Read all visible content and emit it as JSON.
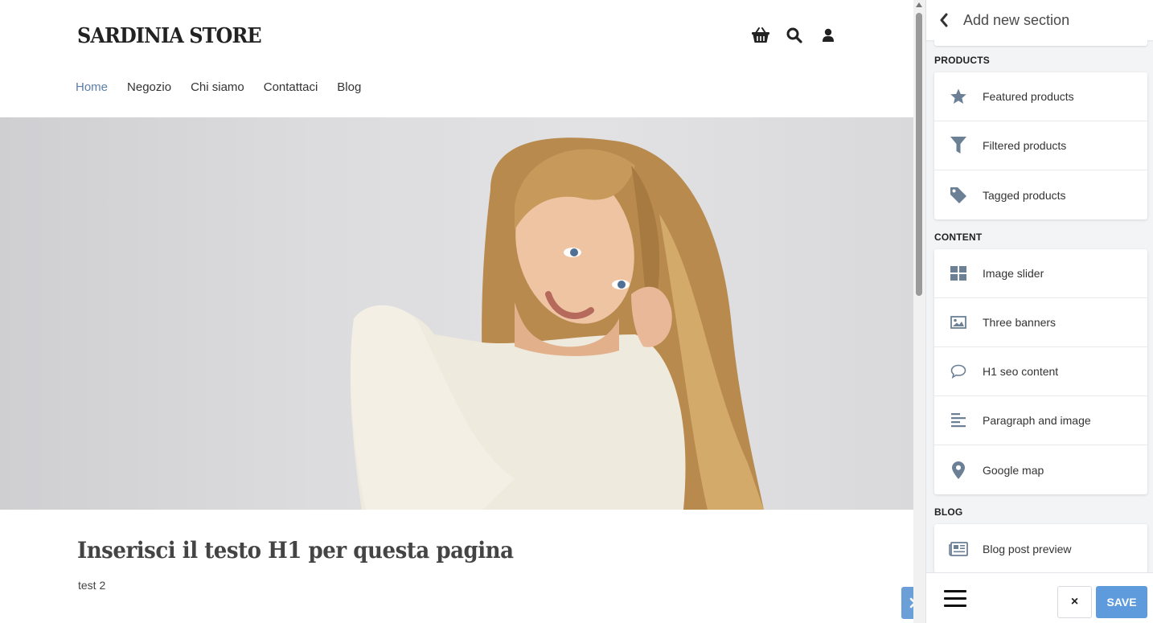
{
  "store": {
    "logo": "SARDINIA STORE",
    "icons": [
      "basket-icon",
      "search-icon",
      "user-icon"
    ],
    "nav": [
      {
        "label": "Home",
        "active": true
      },
      {
        "label": "Negozio",
        "active": false
      },
      {
        "label": "Chi siamo",
        "active": false
      },
      {
        "label": "Contattaci",
        "active": false
      },
      {
        "label": "Blog",
        "active": false
      }
    ],
    "hero_image": "woman-in-white-sweater-photo",
    "h1": "Inserisci il testo H1 per questa pagina",
    "subtext": "test 2"
  },
  "panel": {
    "title": "Add new section",
    "groups": [
      {
        "label": "PRODUCTS",
        "items": [
          {
            "label": "Featured products",
            "icon": "star-icon"
          },
          {
            "label": "Filtered products",
            "icon": "funnel-icon"
          },
          {
            "label": "Tagged products",
            "icon": "tag-icon"
          }
        ]
      },
      {
        "label": "CONTENT",
        "items": [
          {
            "label": "Image slider",
            "icon": "grid-icon"
          },
          {
            "label": "Three banners",
            "icon": "image-icon"
          },
          {
            "label": "H1 seo content",
            "icon": "speech-bubble-icon"
          },
          {
            "label": "Paragraph and image",
            "icon": "align-left-icon"
          },
          {
            "label": "Google map",
            "icon": "map-pin-icon"
          }
        ]
      },
      {
        "label": "BLOG",
        "items": [
          {
            "label": "Blog post preview",
            "icon": "newspaper-icon"
          }
        ]
      }
    ],
    "footer": {
      "close_label": "×",
      "save_label": "SAVE"
    }
  },
  "colors": {
    "accent": "#5d9bdc",
    "nav_active": "#5b7fa8",
    "icon_gray": "#6b7f95"
  }
}
